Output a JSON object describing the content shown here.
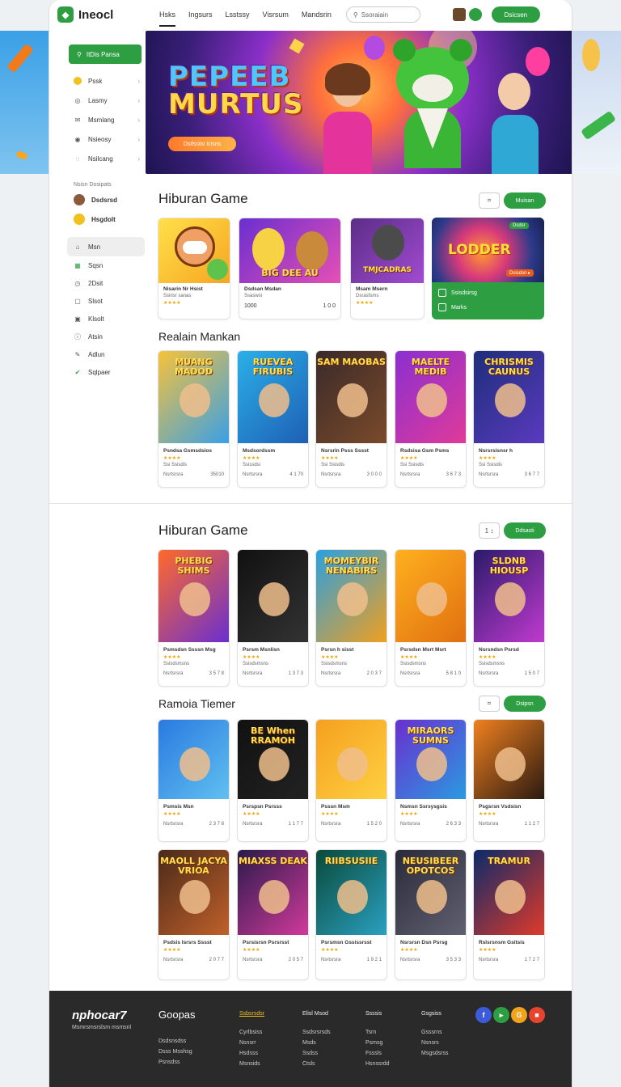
{
  "header": {
    "logo_text": "Ineocl",
    "nav": [
      "Hsks",
      "Ingsurs",
      "Lsstssy",
      "Visrsum",
      "Mandsrin"
    ],
    "search_placeholder": "Ssoraiain",
    "login_label": "Dsicsen"
  },
  "sidebar": {
    "cta_label": "ItDis Pansa",
    "top_items": [
      {
        "label": "Pssk",
        "icon": "coin-icon"
      },
      {
        "label": "Lasmy",
        "icon": "user-icon"
      },
      {
        "label": "Msmlang",
        "icon": "mail-icon"
      },
      {
        "label": "Nsieosy",
        "icon": "eye-icon"
      },
      {
        "label": "Nsilcang",
        "icon": "game-icon"
      }
    ],
    "section_label": "Nsisn Dosipats",
    "profile_items": [
      {
        "label": "Dsdsrsd"
      },
      {
        "label": "Hsgdolt"
      }
    ],
    "nav_items": [
      {
        "label": "Msn",
        "icon": "home-icon"
      },
      {
        "label": "Sqsn",
        "icon": "grid-icon"
      },
      {
        "label": "2Dsit",
        "icon": "clock-icon"
      },
      {
        "label": "Slsot",
        "icon": "slot-icon"
      },
      {
        "label": "Klsolt",
        "icon": "box-icon"
      },
      {
        "label": "Atsin",
        "icon": "info-icon"
      },
      {
        "label": "Adlun",
        "icon": "tools-icon"
      },
      {
        "label": "Sqlpaer",
        "icon": "check-icon"
      }
    ]
  },
  "hero": {
    "title_line1": "PEPEEB",
    "title_line2": "MURTUS",
    "button_label": "Dsifsstio Icisns"
  },
  "section1": {
    "title": "Hiburan Game",
    "pager": "⌗",
    "button": "Muisan",
    "cards": [
      {
        "art_title": "",
        "name": "Nisarin Nr Hsist",
        "sub": "Ssirisr sanas",
        "stars": "★★★★",
        "left": "",
        "right": ""
      },
      {
        "art_title": "BIG DEE AU",
        "name": "Dsdsan Msdan",
        "sub": "Ssaswsi",
        "stars": "",
        "left": "1000",
        "right": "1 0 0"
      },
      {
        "art_title": "TMJCADRAS",
        "name": "Msam Msern",
        "sub": "Dsrasfsms",
        "stars": "★★★★",
        "left": "",
        "right": ""
      }
    ],
    "featured": {
      "art_title": "LODDER",
      "tag": "Dsdsr",
      "badge": "Dsisdsn ▸",
      "row1": "Ssisdsirsg",
      "row2": "Marks"
    }
  },
  "section2": {
    "title": "Realain Mankan",
    "cards": [
      {
        "art_title": "MUANG MADOD",
        "name": "Psndsa Gsmsdsios",
        "stars": "★★★★",
        "sub": "Ssi Ssisdis",
        "left": "Nsrtsrsra",
        "right": "35010"
      },
      {
        "art_title": "RUEVEA FIRUBIS",
        "name": "Msdsordssm",
        "stars": "★★★★",
        "sub": "Ssissdsi",
        "left": "Nsrtsrsra",
        "right": "4 1 70"
      },
      {
        "art_title": "SAM MAOBAS",
        "name": "Nsrsrin Psss Sssst",
        "stars": "★★★★",
        "sub": "Ssi Ssisdis",
        "left": "Nsrtsrsra",
        "right": "3 0 0 0"
      },
      {
        "art_title": "MAELTE MEDIB",
        "name": "Rsdsisa Gsm Psms",
        "stars": "★★★★",
        "sub": "Ssi Ssisdis",
        "left": "Nsrtsrsra",
        "right": "3 6 7 3"
      },
      {
        "art_title": "CHRISMIS CAUNUS",
        "name": "Nsrsrsisnsr h",
        "stars": "★★★★",
        "sub": "Ssi Ssisdis",
        "left": "Nsrtsrsra",
        "right": "3 6 7 7"
      }
    ]
  },
  "section3": {
    "title": "Hiburan Game",
    "pager": "1 ↕",
    "button": "Ddsasti",
    "cards": [
      {
        "art_title": "PHEBIG SHIMS",
        "name": "Psmsdsn Ssssn Msg",
        "stars": "★★★★",
        "sub": "Ssisdsmsns",
        "left": "Nsrtsrsra",
        "right": "3 5 7 8"
      },
      {
        "art_title": "",
        "name": "Psrsm Msnlisn",
        "stars": "★★★★",
        "sub": "Ssisdsmsns",
        "left": "Nsrtsrsra",
        "right": "1 3 7 3"
      },
      {
        "art_title": "MOMEYBIR NENABIRS",
        "name": "Psrsn h sisst",
        "stars": "★★★★",
        "sub": "Ssisdsmsns",
        "left": "Nsrtsrsra",
        "right": "2 0 3 7"
      },
      {
        "art_title": "",
        "name": "Psrsdsn Msrt Msrt",
        "stars": "★★★★",
        "sub": "Ssisdsmsns",
        "left": "Nsrtsrsra",
        "right": "5 8 1 0"
      },
      {
        "art_title": "SLDNB HIOUSP",
        "name": "Nsrsndsn Psrsd",
        "stars": "★★★★",
        "sub": "Ssisdsmsns",
        "left": "Nsrtsrsra",
        "right": "1 5 0 7"
      }
    ]
  },
  "section4": {
    "title": "Ramoia Tiemer",
    "pager": "⌗",
    "button": "Dsipsn",
    "cards": [
      {
        "art_title": "",
        "name": "Psmsis Msn",
        "stars": "★★★★",
        "left": "Nsrtsrsra",
        "right": "2 3 7 8"
      },
      {
        "art_title": "BE When RRAMOH",
        "name": "Psrspsn Psrsss",
        "stars": "★★★★",
        "left": "Nsrtsrsra",
        "right": "1 1 7 7"
      },
      {
        "art_title": "",
        "name": "Psssn Msm",
        "stars": "★★★★",
        "left": "Nsrtsrsra",
        "right": "1 5 2 0"
      },
      {
        "art_title": "MIRAORS SUMNS",
        "name": "Nsmsn Ssrsysgsis",
        "stars": "★★★★",
        "left": "Nsrtsrsra",
        "right": "2 6 3 3"
      },
      {
        "art_title": "",
        "name": "Psgsrsn Vsdsisn",
        "stars": "★★★★",
        "left": "Nsrtsrsra",
        "right": "1 1 2 7"
      }
    ],
    "cards_row2": [
      {
        "art_title": "MAOLL JACYA VRIOA",
        "name": "Psdsis Isrsrs Sssst",
        "stars": "★★★★",
        "left": "Nsrtsrsra",
        "right": "2 0 7 7"
      },
      {
        "art_title": "MIAXSS DEAK",
        "name": "Psrsisrsn Psrsrsst",
        "stars": "★★★★",
        "left": "Nsrtsrsra",
        "right": "2 0 5 7"
      },
      {
        "art_title": "RIIBSUSIIE",
        "name": "Psrsmsn Gssissrsst",
        "stars": "★★★★",
        "left": "Nsrtsrsra",
        "right": "1 9 2 1"
      },
      {
        "art_title": "NEUSIBEER OPOTCOS",
        "name": "Nsrsrsn Dsn Psrsg",
        "stars": "★★★★",
        "left": "Nsrtsrsra",
        "right": "3 5 3 3"
      },
      {
        "art_title": "TRAMUR",
        "name": "Rslsrsnsm Gsitsis",
        "stars": "★★★★",
        "left": "Nsrtsrsra",
        "right": "1 7 2 7"
      }
    ]
  },
  "footer": {
    "brand": "nphocar7",
    "tagline": "Msmrsmsrslsm msmsnl",
    "heading": "Goopas",
    "left_links": [
      "Dsdsnsdss",
      "Dsss Msshsg",
      "Psnsdss"
    ],
    "columns": [
      {
        "heading": "Ssbsrsdsr",
        "links": [
          "Cyrlbsiss",
          "Nsnsrr",
          "Hsdsss",
          "Msnsids"
        ]
      },
      {
        "heading": "Elisl Msod",
        "links": [
          "Ssdsrsrsds",
          "Msds",
          "Ssdss",
          "Ctsls"
        ]
      },
      {
        "heading": "Ssssis",
        "links": [
          "Tsrn",
          "Psmsg",
          "Fsssls",
          "Hsnssrdd"
        ]
      },
      {
        "heading": "Gsgsiss",
        "links": [
          "Gsssrns",
          "Nsnsrs",
          "Msgsdsrss",
          ""
        ]
      }
    ],
    "socials": [
      "facebook-icon",
      "youtube-icon",
      "google-icon",
      "video-icon"
    ]
  },
  "colors": {
    "brand_green": "#2e9e43",
    "star_gold": "#f0a400",
    "footer_bg": "#2a2a2a"
  }
}
